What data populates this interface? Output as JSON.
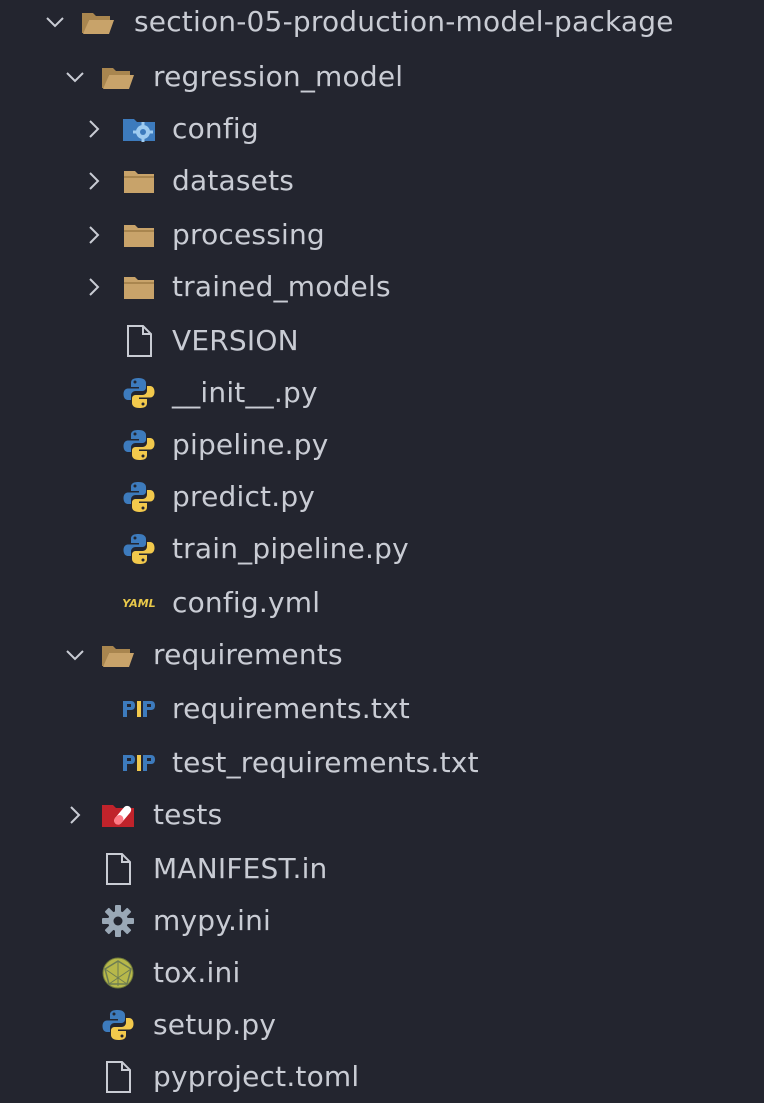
{
  "theme": {
    "background": "#23252f",
    "text": "#c9ccd4",
    "folder": "#c8a36a",
    "python_blue": "#3d7bbd",
    "python_yellow": "#f2c94c"
  },
  "tree": {
    "root": {
      "label": "section-05-production-model-package",
      "expanded": true,
      "icon": "folder-open-icon"
    },
    "regression_model": {
      "label": "regression_model",
      "expanded": true,
      "icon": "folder-open-icon"
    },
    "config": {
      "label": "config",
      "expanded": false,
      "icon": "folder-config-icon"
    },
    "datasets": {
      "label": "datasets",
      "expanded": false,
      "icon": "folder-icon"
    },
    "processing": {
      "label": "processing",
      "expanded": false,
      "icon": "folder-icon"
    },
    "trained_models": {
      "label": "trained_models",
      "expanded": false,
      "icon": "folder-icon"
    },
    "version": {
      "label": "VERSION",
      "icon": "file-icon"
    },
    "init_py": {
      "label": "__init__.py",
      "icon": "python-icon"
    },
    "pipeline_py": {
      "label": "pipeline.py",
      "icon": "python-icon"
    },
    "predict_py": {
      "label": "predict.py",
      "icon": "python-icon"
    },
    "train_pipeline_py": {
      "label": "train_pipeline.py",
      "icon": "python-icon"
    },
    "config_yml": {
      "label": "config.yml",
      "icon": "yaml-icon",
      "icon_text": "YAML"
    },
    "requirements": {
      "label": "requirements",
      "expanded": true,
      "icon": "folder-open-icon"
    },
    "requirements_txt": {
      "label": "requirements.txt",
      "icon": "pip-icon"
    },
    "test_requirements_txt": {
      "label": "test_requirements.txt",
      "icon": "pip-icon"
    },
    "tests": {
      "label": "tests",
      "expanded": false,
      "icon": "folder-test-icon"
    },
    "manifest": {
      "label": "MANIFEST.in",
      "icon": "file-icon"
    },
    "mypy_ini": {
      "label": "mypy.ini",
      "icon": "gear-icon"
    },
    "tox_ini": {
      "label": "tox.ini",
      "icon": "tox-icon"
    },
    "setup_py": {
      "label": "setup.py",
      "icon": "python-icon"
    },
    "pyproject": {
      "label": "pyproject.toml",
      "icon": "file-icon"
    }
  }
}
